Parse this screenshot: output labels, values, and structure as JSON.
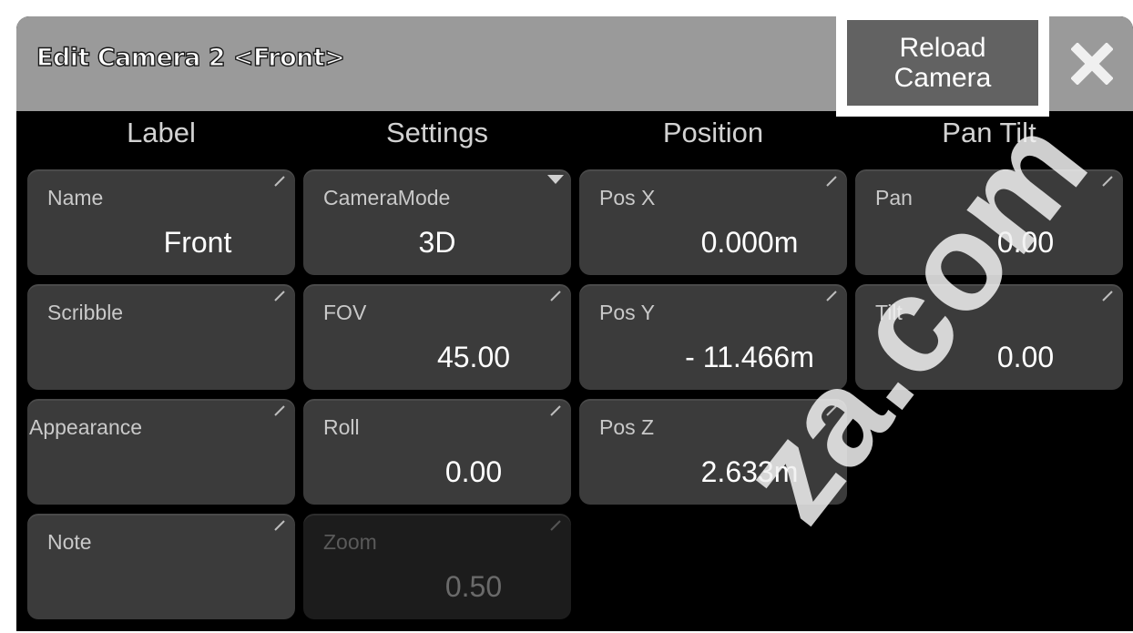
{
  "dialog": {
    "title": "Edit Camera 2 <Front>",
    "reload_line1": "Reload",
    "reload_line2": "Camera",
    "close_icon": "close-x-icon"
  },
  "columns": {
    "label": "Label",
    "settings": "Settings",
    "position": "Position",
    "pantilt": "Pan Tilt"
  },
  "label": {
    "name": {
      "label": "Name",
      "value": "Front"
    },
    "scribble": {
      "label": "Scribble",
      "value": ""
    },
    "appearance": {
      "label": "Appearance",
      "value": ""
    },
    "note": {
      "label": "Note",
      "value": ""
    }
  },
  "settings": {
    "camera_mode": {
      "label": "CameraMode",
      "value": "3D"
    },
    "fov": {
      "label": "FOV",
      "value": "45.00"
    },
    "roll": {
      "label": "Roll",
      "value": "0.00"
    },
    "zoom": {
      "label": "Zoom",
      "value": "0.50",
      "disabled": true
    }
  },
  "position": {
    "pos_x": {
      "label": "Pos X",
      "value": "0.000m"
    },
    "pos_y": {
      "label": "Pos Y",
      "value": "- 11.466m"
    },
    "pos_z": {
      "label": "Pos Z",
      "value": "2.633m"
    }
  },
  "pantilt": {
    "pan": {
      "label": "Pan",
      "value": "0.00"
    },
    "tilt": {
      "label": "Tilt",
      "value": "0.00"
    }
  },
  "colors": {
    "titlebar": "#9a9a9a",
    "button": "#626262",
    "cell": "#3b3b3b",
    "cell_disabled": "#1c1c1c",
    "background": "#000000"
  },
  "watermark": "za.com"
}
